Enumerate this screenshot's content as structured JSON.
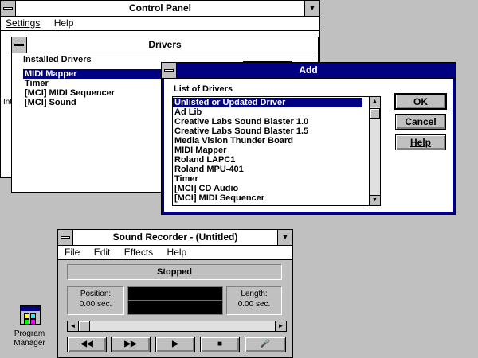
{
  "control_panel": {
    "title": "Control Panel",
    "menu": [
      "Settings",
      "Help"
    ],
    "minimize_glyph": "▼",
    "partial_label": "Int"
  },
  "drivers": {
    "title": "Drivers",
    "installed_label": "Installed Drivers",
    "items": [
      "MIDI Mapper",
      "Timer",
      "[MCI] MIDI Sequencer",
      "[MCI] Sound"
    ]
  },
  "add": {
    "title": "Add",
    "list_label": "List of Drivers",
    "items": [
      "Unlisted or Updated Driver",
      "Ad Lib",
      "Creative Labs Sound Blaster 1.0",
      "Creative Labs Sound Blaster 1.5",
      "Media Vision Thunder Board",
      "MIDI Mapper",
      "Roland LAPC1",
      "Roland MPU-401",
      "Timer",
      "[MCI] CD Audio",
      "[MCI] MIDI Sequencer"
    ],
    "buttons": {
      "ok": "OK",
      "cancel": "Cancel",
      "help": "Help"
    },
    "scroll_up": "▲",
    "scroll_down": "▼"
  },
  "recorder": {
    "title": "Sound Recorder - (Untitled)",
    "menu": [
      "File",
      "Edit",
      "Effects",
      "Help"
    ],
    "status": "Stopped",
    "position_label": "Position:",
    "position_value": "0.00 sec.",
    "length_label": "Length:",
    "length_value": "0.00 sec.",
    "scroll_left": "◄",
    "scroll_right": "►",
    "minimize_glyph": "▼",
    "controls": [
      "◀◀",
      "▶▶",
      "▶",
      "■",
      "🎤"
    ]
  },
  "desktop": {
    "program_manager_label": "Program Manager"
  }
}
